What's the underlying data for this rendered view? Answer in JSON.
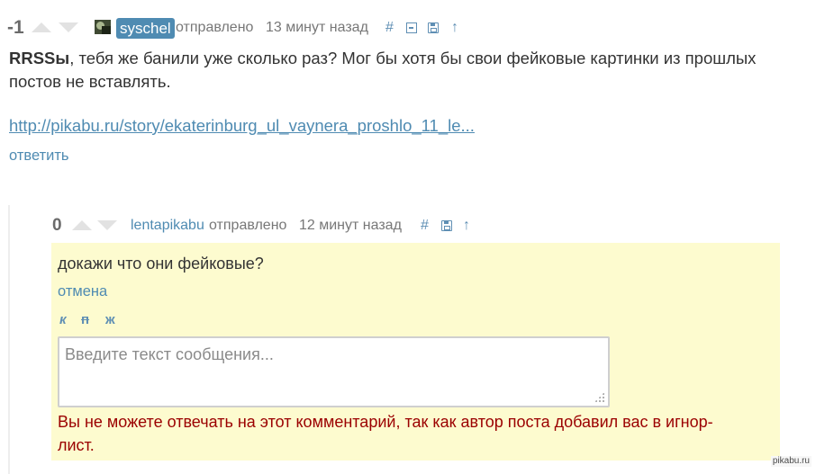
{
  "comment1": {
    "score": "-1",
    "username": "syschel",
    "sent_label": "отправлено",
    "time": "13 минут назад",
    "actions": {
      "permalink": "#",
      "collapse_icon": "minus-square-icon",
      "save_icon": "floppy-icon",
      "parent_icon": "arrow-up-icon",
      "parent": "↑"
    },
    "mention": "RRSSы",
    "text_rest": ", тебя же банили уже сколько раз? Мог бы хотя бы свои фейковые картинки из прошлых постов не вставлять.",
    "link": "http://pikabu.ru/story/ekaterinburg_ul_vaynera_proshlo_11_le...",
    "reply": "ответить"
  },
  "comment2": {
    "score": "0",
    "username": "lentapikabu",
    "sent_label": "отправлено",
    "time": "12 минут назад",
    "actions": {
      "permalink": "#",
      "save_icon": "floppy-icon",
      "parent_icon": "arrow-up-icon",
      "parent": "↑"
    },
    "text": "докажи что они фейковые?",
    "cancel": "отмена",
    "format": {
      "italic": "к",
      "strike": "п",
      "bold": "ж"
    },
    "textarea_placeholder": "Введите текст сообщения...",
    "error": "Вы не можете отвечать на этот комментарий, так как автор поста добавил вас в игнор-лист."
  },
  "watermark": "pikabu.ru",
  "colors": {
    "accent": "#4f8bb2",
    "highlight_bg": "#fdfbcf",
    "error": "#9b0000",
    "badge_bg": "#4f8bb2"
  }
}
